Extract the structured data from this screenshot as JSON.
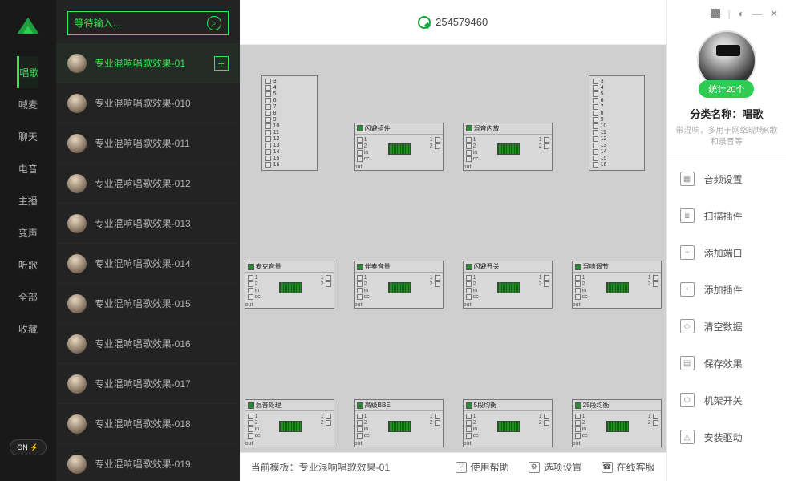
{
  "search": {
    "placeholder": "等待输入..."
  },
  "categories": [
    {
      "label": "唱歌",
      "active": true
    },
    {
      "label": "喊麦",
      "active": false
    },
    {
      "label": "聊天",
      "active": false
    },
    {
      "label": "电音",
      "active": false
    },
    {
      "label": "主播",
      "active": false
    },
    {
      "label": "变声",
      "active": false
    },
    {
      "label": "听歌",
      "active": false
    },
    {
      "label": "全部",
      "active": false
    },
    {
      "label": "收藏",
      "active": false
    }
  ],
  "toggle": {
    "label": "ON ⚡"
  },
  "effects": [
    {
      "name": "专业混响唱歌效果-01",
      "active": true,
      "plus": true
    },
    {
      "name": "专业混响唱歌效果-010",
      "active": false
    },
    {
      "name": "专业混响唱歌效果-011",
      "active": false
    },
    {
      "name": "专业混响唱歌效果-012",
      "active": false
    },
    {
      "name": "专业混响唱歌效果-013",
      "active": false
    },
    {
      "name": "专业混响唱歌效果-014",
      "active": false
    },
    {
      "name": "专业混响唱歌效果-015",
      "active": false
    },
    {
      "name": "专业混响唱歌效果-016",
      "active": false
    },
    {
      "name": "专业混响唱歌效果-017",
      "active": false
    },
    {
      "name": "专业混响唱歌效果-018",
      "active": false
    },
    {
      "name": "专业混响唱歌效果-019",
      "active": false
    }
  ],
  "header": {
    "number": "254579460"
  },
  "nodes": {
    "row0": [
      {
        "kind": "io",
        "title": "",
        "ports": [
          "3",
          "4",
          "5",
          "6",
          "7",
          "8",
          "9",
          "10",
          "11",
          "12",
          "13",
          "14",
          "15",
          "16"
        ]
      },
      {
        "kind": "unit",
        "title": "闪避插件"
      },
      {
        "kind": "unit",
        "title": "混音内放"
      },
      {
        "kind": "io",
        "title": "",
        "ports": [
          "3",
          "4",
          "5",
          "6",
          "7",
          "8",
          "9",
          "10",
          "11",
          "12",
          "13",
          "14",
          "15",
          "16"
        ]
      }
    ],
    "row1": [
      {
        "kind": "unit",
        "title": "麦克音量"
      },
      {
        "kind": "unit",
        "title": "伴奏音量"
      },
      {
        "kind": "unit",
        "title": "闪避开关"
      },
      {
        "kind": "unit",
        "title": "混响调节"
      }
    ],
    "row2": [
      {
        "kind": "unit",
        "title": "混音处理"
      },
      {
        "kind": "unit",
        "title": "高级BBE"
      },
      {
        "kind": "unit",
        "title": "5段均衡"
      },
      {
        "kind": "unit",
        "title": "25段均衡"
      }
    ]
  },
  "node_port_labels": {
    "in": "in",
    "cc": "cc",
    "out": "out",
    "p1": "1",
    "p2": "2"
  },
  "footer": {
    "template_prefix": "当前模板：",
    "template_name": "专业混响唱歌效果-01",
    "links": [
      {
        "label": "使用帮助"
      },
      {
        "label": "选项设置"
      },
      {
        "label": "在线客服"
      }
    ]
  },
  "right": {
    "stat_pill": "统计20个",
    "title_prefix": "分类名称：",
    "title_value": "唱歌",
    "desc": "带混响，多用于网络现场K歌和录音等",
    "menu": [
      {
        "label": "音频设置",
        "icon": "audio-settings-icon"
      },
      {
        "label": "扫描插件",
        "icon": "scan-plugin-icon"
      },
      {
        "label": "添加端口",
        "icon": "add-port-icon"
      },
      {
        "label": "添加插件",
        "icon": "add-plugin-icon"
      },
      {
        "label": "清空数据",
        "icon": "clear-data-icon"
      },
      {
        "label": "保存效果",
        "icon": "save-effect-icon"
      },
      {
        "label": "机架开关",
        "icon": "rack-switch-icon"
      },
      {
        "label": "安装驱动",
        "icon": "install-driver-icon"
      }
    ]
  },
  "window_controls": {
    "grid": "",
    "sep": "|",
    "theme": "◐",
    "min": "—",
    "close": "✕"
  }
}
